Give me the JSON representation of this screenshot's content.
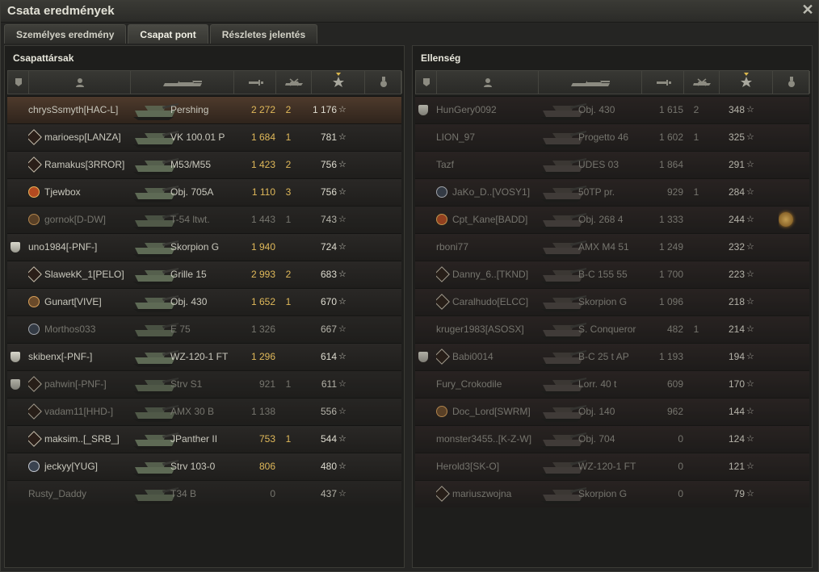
{
  "window": {
    "title": "Csata eredmények",
    "close_icon": "close-icon"
  },
  "tabs": [
    {
      "label": "Személyes eredmény",
      "active": false
    },
    {
      "label": "Csapat pont",
      "active": true
    },
    {
      "label": "Részletes jelentés",
      "active": false
    }
  ],
  "columns": {
    "icons": [
      "clan-badge-icon",
      "player-icon",
      "tank-icon",
      "damage-icon",
      "kills-icon",
      "xp-star-icon",
      "medal-icon"
    ],
    "sorted_column": "xp"
  },
  "allies": {
    "title": "Csapattársak",
    "rows": [
      {
        "badge": false,
        "rank": "",
        "name": "chrysSsmyth[HAC-L]",
        "vehicle": "Pershing",
        "damage": "2 272",
        "kills": "2",
        "xp": "1 176",
        "me": true,
        "dead": false,
        "medal": false
      },
      {
        "badge": false,
        "rank": "diamond",
        "name": "marioesp[LANZA]",
        "vehicle": "VK 100.01 P",
        "damage": "1 684",
        "kills": "1",
        "xp": "781",
        "me": false,
        "dead": false,
        "medal": false
      },
      {
        "badge": false,
        "rank": "diamond",
        "name": "Ramakus[3RROR]",
        "vehicle": "M53/M55",
        "damage": "1 423",
        "kills": "2",
        "xp": "756",
        "me": false,
        "dead": false,
        "medal": false
      },
      {
        "badge": false,
        "rank": "gold",
        "name": "Tjewbox",
        "vehicle": "Obj. 705A",
        "damage": "1 110",
        "kills": "3",
        "xp": "756",
        "me": false,
        "dead": false,
        "medal": false
      },
      {
        "badge": false,
        "rank": "bronze",
        "name": "gornok[D-DW]",
        "vehicle": "T-54 ltwt.",
        "damage": "1 443",
        "kills": "1",
        "xp": "743",
        "me": false,
        "dead": true,
        "medal": false
      },
      {
        "badge": true,
        "rank": "",
        "name": "uno1984[-PNF-]",
        "vehicle": "Skorpion G",
        "damage": "1 940",
        "kills": "",
        "xp": "724",
        "me": false,
        "dead": false,
        "medal": false
      },
      {
        "badge": false,
        "rank": "diamond",
        "name": "SlawekK_1[PELO]",
        "vehicle": "Grille 15",
        "damage": "2 993",
        "kills": "2",
        "xp": "683",
        "me": false,
        "dead": false,
        "medal": false
      },
      {
        "badge": false,
        "rank": "bronze",
        "name": "Gunart[VIVE]",
        "vehicle": "Obj. 430",
        "damage": "1 652",
        "kills": "1",
        "xp": "670",
        "me": false,
        "dead": false,
        "medal": false
      },
      {
        "badge": false,
        "rank": "silver",
        "name": "Morthos033",
        "vehicle": "E 75",
        "damage": "1 326",
        "kills": "",
        "xp": "667",
        "me": false,
        "dead": true,
        "medal": false
      },
      {
        "badge": true,
        "rank": "",
        "name": "skibenx[-PNF-]",
        "vehicle": "WZ-120-1 FT",
        "damage": "1 296",
        "kills": "",
        "xp": "614",
        "me": false,
        "dead": false,
        "medal": false
      },
      {
        "badge": true,
        "rank": "diamond",
        "name": "pahwin[-PNF-]",
        "vehicle": "Strv S1",
        "damage": "921",
        "kills": "1",
        "xp": "611",
        "me": false,
        "dead": true,
        "medal": false
      },
      {
        "badge": false,
        "rank": "diamond",
        "name": "vadam11[HHD-]",
        "vehicle": "AMX 30 B",
        "damage": "1 138",
        "kills": "",
        "xp": "556",
        "me": false,
        "dead": true,
        "medal": false
      },
      {
        "badge": false,
        "rank": "diamond",
        "name": "maksim..[_SRB_]",
        "vehicle": "JPanther II",
        "damage": "753",
        "kills": "1",
        "xp": "544",
        "me": false,
        "dead": false,
        "medal": false
      },
      {
        "badge": false,
        "rank": "silver",
        "name": "jeckyy[YUG]",
        "vehicle": "Strv 103-0",
        "damage": "806",
        "kills": "",
        "xp": "480",
        "me": false,
        "dead": false,
        "medal": false
      },
      {
        "badge": false,
        "rank": "",
        "name": "Rusty_Daddy",
        "vehicle": "T34 B",
        "damage": "0",
        "kills": "",
        "xp": "437",
        "me": false,
        "dead": true,
        "medal": false
      }
    ]
  },
  "enemies": {
    "title": "Ellenség",
    "rows": [
      {
        "badge": true,
        "rank": "",
        "name": "HunGery0092",
        "vehicle": "Obj. 430",
        "damage": "1 615",
        "kills": "2",
        "xp": "348",
        "dead": true,
        "medal": false
      },
      {
        "badge": false,
        "rank": "",
        "name": "LION_97",
        "vehicle": "Progetto 46",
        "damage": "1 602",
        "kills": "1",
        "xp": "325",
        "dead": true,
        "medal": false
      },
      {
        "badge": false,
        "rank": "",
        "name": "Tazf",
        "vehicle": "UDES 03",
        "damage": "1 864",
        "kills": "",
        "xp": "291",
        "dead": true,
        "medal": false
      },
      {
        "badge": false,
        "rank": "silver",
        "name": "JaKo_D..[VOSY1]",
        "vehicle": "50TP pr.",
        "damage": "929",
        "kills": "1",
        "xp": "284",
        "dead": true,
        "medal": false
      },
      {
        "badge": false,
        "rank": "gold",
        "name": "Cpt_Kane[BADD]",
        "vehicle": "Obj. 268 4",
        "damage": "1 333",
        "kills": "",
        "xp": "244",
        "dead": true,
        "medal": true
      },
      {
        "badge": false,
        "rank": "",
        "name": "rboni77",
        "vehicle": "AMX M4 51",
        "damage": "1 249",
        "kills": "",
        "xp": "232",
        "dead": true,
        "medal": false
      },
      {
        "badge": false,
        "rank": "diamond",
        "name": "Danny_6..[TKND]",
        "vehicle": "B-C 155 55",
        "damage": "1 700",
        "kills": "",
        "xp": "223",
        "dead": true,
        "medal": false
      },
      {
        "badge": false,
        "rank": "diamond",
        "name": "Caralhudo[ELCC]",
        "vehicle": "Skorpion G",
        "damage": "1 096",
        "kills": "",
        "xp": "218",
        "dead": true,
        "medal": false
      },
      {
        "badge": false,
        "rank": "",
        "name": "kruger1983[ASOSX]",
        "vehicle": "S. Conqueror",
        "damage": "482",
        "kills": "1",
        "xp": "214",
        "dead": true,
        "medal": false
      },
      {
        "badge": true,
        "rank": "diamond",
        "name": "Babi0014",
        "vehicle": "B-C 25 t AP",
        "damage": "1 193",
        "kills": "",
        "xp": "194",
        "dead": true,
        "medal": false
      },
      {
        "badge": false,
        "rank": "",
        "name": "Fury_Crokodile",
        "vehicle": "Lorr. 40 t",
        "damage": "609",
        "kills": "",
        "xp": "170",
        "dead": true,
        "medal": false
      },
      {
        "badge": false,
        "rank": "bronze",
        "name": "Doc_Lord[SWRM]",
        "vehicle": "Obj. 140",
        "damage": "962",
        "kills": "",
        "xp": "144",
        "dead": true,
        "medal": false
      },
      {
        "badge": false,
        "rank": "",
        "name": "monster3455..[K-Z-W]",
        "vehicle": "Obj. 704",
        "damage": "0",
        "kills": "",
        "xp": "124",
        "dead": true,
        "medal": false
      },
      {
        "badge": false,
        "rank": "",
        "name": "Herold3[SK-O]",
        "vehicle": "WZ-120-1 FT",
        "damage": "0",
        "kills": "",
        "xp": "121",
        "dead": true,
        "medal": false
      },
      {
        "badge": false,
        "rank": "diamond",
        "name": "mariuszwojna",
        "vehicle": "Skorpion G",
        "damage": "0",
        "kills": "",
        "xp": "79",
        "dead": true,
        "medal": false
      }
    ]
  },
  "colors": {
    "accent": "#e0b95a",
    "me_row": "#4e3a2c",
    "medal_glow": "#d0902a"
  }
}
